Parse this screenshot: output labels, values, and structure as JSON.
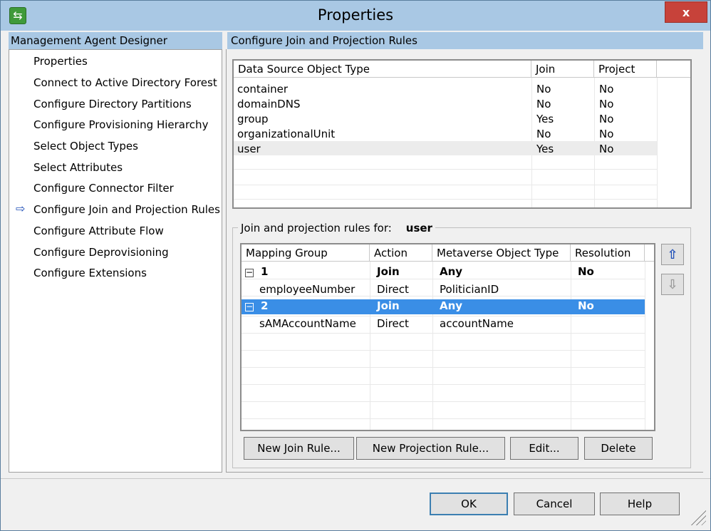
{
  "window": {
    "title": "Properties",
    "close_label": "x"
  },
  "left": {
    "header": "Management Agent Designer",
    "items": [
      "Properties",
      "Connect to Active Directory Forest",
      "Configure Directory Partitions",
      "Configure Provisioning Hierarchy",
      "Select Object Types",
      "Select Attributes",
      "Configure Connector Filter",
      "Configure Join and Projection Rules",
      "Configure Attribute Flow",
      "Configure Deprovisioning",
      "Configure Extensions"
    ],
    "current_index": 7,
    "current_marker": "⇨"
  },
  "right": {
    "header": "Configure Join and Projection Rules",
    "object_table": {
      "headers": [
        "Data Source Object Type",
        "Join",
        "Project"
      ],
      "rows": [
        [
          "container",
          "No",
          "No"
        ],
        [
          "domainDNS",
          "No",
          "No"
        ],
        [
          "group",
          "Yes",
          "No"
        ],
        [
          "organizationalUnit",
          "No",
          "No"
        ],
        [
          "user",
          "Yes",
          "No"
        ]
      ]
    },
    "rules_label": "Join and projection rules for:",
    "rules_object": "user",
    "rules_table": {
      "headers": [
        "Mapping Group",
        "Action",
        "Metaverse Object Type",
        "Resolution"
      ],
      "rows": [
        [
          "1",
          "Join",
          "Any",
          "No"
        ],
        [
          "employeeNumber",
          "Direct",
          "PoliticianID",
          ""
        ],
        [
          "2",
          "Join",
          "Any",
          "No"
        ],
        [
          "sAMAccountName",
          "Direct",
          "accountName",
          ""
        ]
      ]
    },
    "buttons": {
      "new_join": "New Join Rule...",
      "new_projection": "New Projection Rule...",
      "edit": "Edit...",
      "delete": "Delete"
    }
  },
  "footer": {
    "ok": "OK",
    "cancel": "Cancel",
    "help": "Help"
  }
}
